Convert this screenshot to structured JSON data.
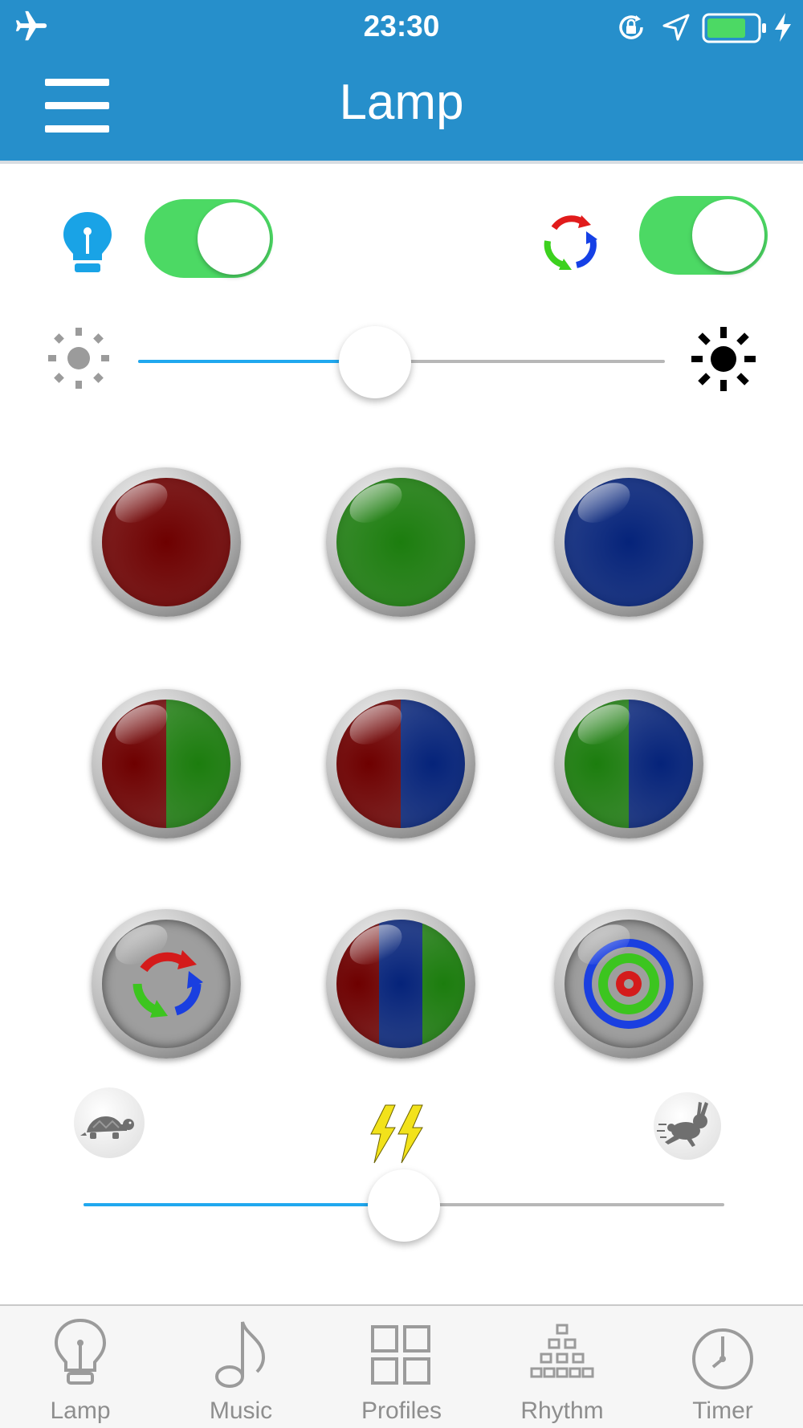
{
  "status_bar": {
    "time": "23:30",
    "icons": [
      "airplane-icon",
      "rotation-lock-icon",
      "location-icon",
      "battery-icon",
      "charging-icon"
    ],
    "battery_color": "#4cd964"
  },
  "nav": {
    "title": "Lamp",
    "menu_icon": "hamburger-menu-icon",
    "background": "#268fcb"
  },
  "controls": {
    "power_toggle": {
      "icon": "lightbulb-icon",
      "on": true
    },
    "auto_cycle_toggle": {
      "icon": "color-cycle-icon",
      "on": true
    },
    "brightness": {
      "min_icon": "sun-dim-icon",
      "max_icon": "sun-bright-icon",
      "value": 0.45
    },
    "speed": {
      "min_icon": "turtle-icon",
      "max_icon": "rabbit-icon",
      "center_icon": "lightning-icon",
      "value": 0.5
    }
  },
  "color_buttons": [
    {
      "name": "red",
      "colors": [
        "#6e0000"
      ]
    },
    {
      "name": "green",
      "colors": [
        "#1c7d0e"
      ]
    },
    {
      "name": "blue",
      "colors": [
        "#05237a"
      ]
    },
    {
      "name": "red-green",
      "colors": [
        "#6e0000",
        "#1c7d0e"
      ]
    },
    {
      "name": "red-blue",
      "colors": [
        "#6e0000",
        "#05237a"
      ]
    },
    {
      "name": "green-blue",
      "colors": [
        "#1c7d0e",
        "#05237a"
      ]
    },
    {
      "name": "color-cycle",
      "icon": "color-cycle-icon"
    },
    {
      "name": "red-blue-green",
      "colors": [
        "#6e0000",
        "#05237a",
        "#1c7d0e"
      ]
    },
    {
      "name": "target",
      "icon": "target-rings-icon"
    }
  ],
  "tab_bar": {
    "tabs": [
      {
        "label": "Lamp",
        "icon": "lightbulb-outline-icon"
      },
      {
        "label": "Music",
        "icon": "music-note-icon"
      },
      {
        "label": "Profiles",
        "icon": "grid-squares-icon"
      },
      {
        "label": "Rhythm",
        "icon": "equalizer-blocks-icon"
      },
      {
        "label": "Timer",
        "icon": "clock-icon"
      }
    ]
  }
}
